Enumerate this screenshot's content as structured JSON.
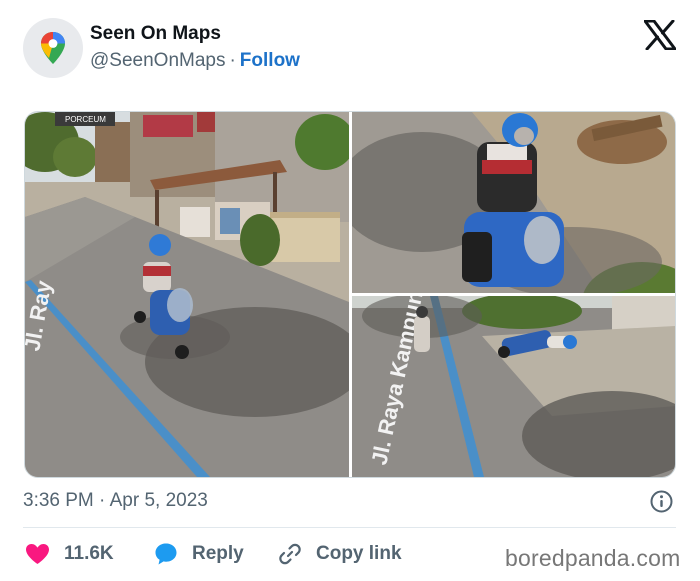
{
  "author": {
    "display_name": "Seen On Maps",
    "handle": "@SeenOnMaps",
    "separator": "·",
    "follow_label": "Follow",
    "avatar_icon": "google-maps-pin-icon"
  },
  "platform_icon": "x-logo-icon",
  "media": {
    "photos": [
      {
        "name": "photo-street-rider",
        "sign_text": "PORCEUM",
        "road_text": "Jl. Ray"
      },
      {
        "name": "photo-rider-closeup"
      },
      {
        "name": "photo-road-fallen-bike",
        "road_text": "Jl. Raya Kampungbaru"
      }
    ]
  },
  "meta": {
    "timestamp": "3:36 PM · Apr 5, 2023",
    "info_icon": "info-icon"
  },
  "actions": {
    "like_count": "11.6K",
    "reply_label": "Reply",
    "copy_link_label": "Copy link"
  },
  "watermark": "boredpanda.com",
  "colors": {
    "accent_blue": "#1d72c9",
    "heart_pink": "#f91880",
    "reply_blue": "#1d9bf0",
    "muted": "#536471"
  }
}
